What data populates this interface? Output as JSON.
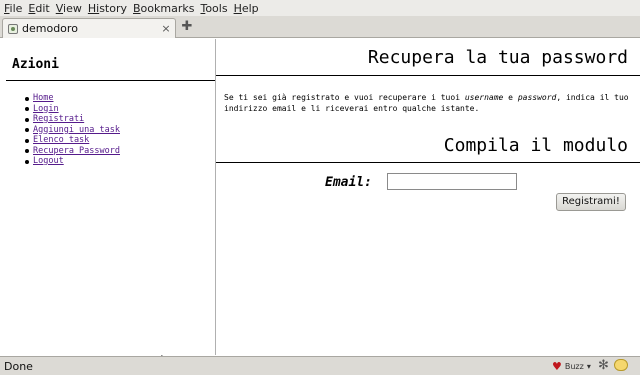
{
  "menubar": {
    "items": [
      {
        "first": "F",
        "rest": "ile"
      },
      {
        "first": "E",
        "rest": "dit"
      },
      {
        "first": "V",
        "rest": "iew"
      },
      {
        "first": "Hi",
        "rest": "story"
      },
      {
        "first": "B",
        "rest": "ookmarks"
      },
      {
        "first": "T",
        "rest": "ools"
      },
      {
        "first": "H",
        "rest": "elp"
      }
    ]
  },
  "tabs": [
    {
      "title": "demodoro",
      "close": "×"
    }
  ],
  "newtab": {
    "symbol": "✚"
  },
  "sidebar": {
    "title": "Azioni",
    "links": [
      "Home",
      "Login",
      "Registrati",
      "Aggiungi una task",
      "Elenco task",
      "Recupera Password",
      "Logout"
    ]
  },
  "main": {
    "heading": "Recupera la tua password",
    "intro": {
      "a": "Se ti sei già registrato e vuoi recuperare i tuoi ",
      "username": "username",
      "b": " e ",
      "password": "password",
      "c": ", indica il tuo indirizzo email e li riceverai entro qualche istante."
    },
    "form_heading": "Compila il modulo",
    "email_label": "Email:",
    "email_value": "",
    "submit_label": "Registrami!"
  },
  "statusbar": {
    "text": "Done",
    "buzz": "Buzz",
    "buzz_arrow": "▾"
  },
  "icons": {
    "heart": "♥",
    "gear": "✻"
  }
}
